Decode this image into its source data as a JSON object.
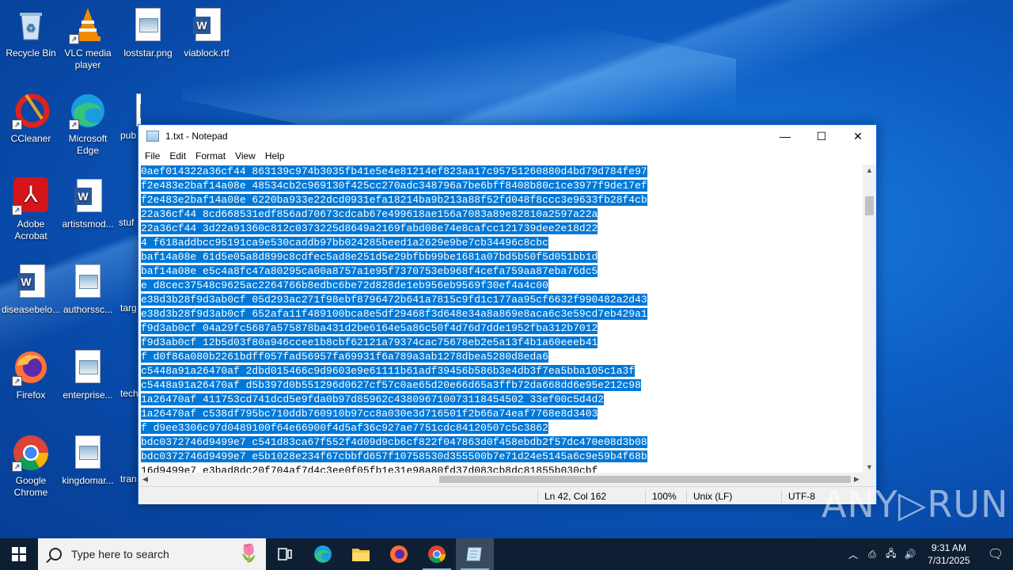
{
  "desktop": {
    "icons": [
      {
        "label": "Recycle Bin",
        "icon": "recycle-bin-icon"
      },
      {
        "label": "VLC media player",
        "icon": "vlc-icon"
      },
      {
        "label": "loststar.png",
        "icon": "image-file-icon"
      },
      {
        "label": "viablock.rtf",
        "icon": "word-document-icon"
      },
      {
        "label": "CCleaner",
        "icon": "ccleaner-icon"
      },
      {
        "label": "Microsoft Edge",
        "icon": "edge-icon"
      },
      {
        "label": "pub",
        "icon": "image-file-icon"
      },
      {
        "label": "Adobe Acrobat",
        "icon": "acrobat-icon"
      },
      {
        "label": "artistsmod...",
        "icon": "word-document-icon"
      },
      {
        "label": "stuf",
        "icon": "image-file-icon"
      },
      {
        "label": "diseasebelo...",
        "icon": "word-document-icon"
      },
      {
        "label": "authorssc...",
        "icon": "image-file-icon"
      },
      {
        "label": "targ",
        "icon": "word-document-icon"
      },
      {
        "label": "Firefox",
        "icon": "firefox-icon"
      },
      {
        "label": "enterprise...",
        "icon": "image-file-icon"
      },
      {
        "label": "tech",
        "icon": "word-document-icon"
      },
      {
        "label": "Google Chrome",
        "icon": "chrome-icon"
      },
      {
        "label": "kingdomar...",
        "icon": "image-file-icon"
      },
      {
        "label": "tran",
        "icon": "image-file-icon"
      }
    ]
  },
  "notepad": {
    "title": "1.txt - Notepad",
    "menu": [
      "File",
      "Edit",
      "Format",
      "View",
      "Help"
    ],
    "lines": [
      {
        "text": "0aef014322a36cf44 863139c974b3035fb41e5e4e81214ef823aa17c95751260880d4bd79d784fe97",
        "selected": true
      },
      {
        "text": "f2e483e2baf14a08e 48534cb2c969130f425cc270adc348796a7be6bff8408b80c1ce3977f9de17ef",
        "selected": true
      },
      {
        "text": "f2e483e2baf14a08e 6220ba933e22dcd0931efa18214ba9b213a88f52fd048f8ccc3e9633fb28f4cb",
        "selected": true
      },
      {
        "text": "22a36cf44 8cd668531edf856ad70673cdcab67e499618ae156a7083a89e82810a2597a22a",
        "selected": true
      },
      {
        "text": "22a36cf44 3d22a91360c812c0373225d8649a2169fabd08e74e8cafcc121739dee2e18d22",
        "selected": true
      },
      {
        "text": "4 f618addbcc95191ca9e530caddb97bb024285beed1a2629e9be7cb34496c8cbc",
        "selected": true
      },
      {
        "text": "baf14a08e 61d5e05a8d899c8cdfec5ad8e251d5e29bfbb99be1681a07bd5b50f5d051bb1d",
        "selected": true
      },
      {
        "text": "baf14a08e e5c4a8fc47a80295ca00a8757a1e95f7370753eb968f4cefa759aa87eba76dc5",
        "selected": true
      },
      {
        "text": "e d8cec37548c9625ac2264766b8edbc6be72d828de1eb956eb9569f30ef4a4c00",
        "selected": true
      },
      {
        "text": "e38d3b28f9d3ab0cf 05d293ac271f98ebf8796472b641a7815c9fd1c177aa95cf6632f990482a2d43",
        "selected": true
      },
      {
        "text": "e38d3b28f9d3ab0cf 652afa11f489100bca8e5df29468f3d648e34a8a869e8aca6c3e59cd7eb429a1",
        "selected": true
      },
      {
        "text": "f9d3ab0cf 04a29fc5687a575878ba431d2be6164e5a86c50f4d76d7dde1952fba312b7012",
        "selected": true
      },
      {
        "text": "f9d3ab0cf 12b5d03f80a946ccee1b8cbf62121a79374cac75678eb2e5a13f4b1a60eeeb41",
        "selected": true
      },
      {
        "text": "f d0f86a080b2261bdff057fad56957fa69931f6a789a3ab1278dbea5280d8eda6",
        "selected": true
      },
      {
        "text": "c5448a91a26470af 2dbd015466c9d9603e9e61111b61adf39456b586b3e4db3f7ea5bba105c1a3f",
        "selected": true
      },
      {
        "text": "c5448a91a26470af d5b397d0b551296d0627cf57c0ae65d20e66d65a3ffb72da668dd6e95e212c98",
        "selected": true
      },
      {
        "text": "1a26470af 411753cd741dcd5e9fda0b97d85962c438096710073118454502 33ef00c5d4d2",
        "selected": true
      },
      {
        "text": "1a26470af c538df795bc710ddb760910b97cc8a030e3d716501f2b66a74eaf7768e8d3403",
        "selected": true
      },
      {
        "text": "f d9ee3306c97d0489100f64e66900f4d5af36c927ae7751cdc84120507c5c3862",
        "selected": true
      },
      {
        "text": "bdc0372746d9499e7 c541d83ca67f552f4d09d9cb6cf822f047863d0f458ebdb2f57dc470e08d3b08",
        "selected": true
      },
      {
        "text": "bdc0372746d9499e7 e5b1028e234f67cbbfd657f10758530d355500b7e71d24e5145a6c9e59b4f68b",
        "selected": true
      },
      {
        "text": "16d9499e7 e3bad8dc20f704af7d4c3ee0f05fb1e31e98a80fd37d083cb8dc81855b030cbf",
        "selected": false
      }
    ],
    "status": {
      "position": "Ln 42, Col 162",
      "zoom": "100%",
      "line_endings": "Unix (LF)",
      "encoding": "UTF-8"
    }
  },
  "watermark": "ANY▷RUN",
  "taskbar": {
    "search_placeholder": "Type here to search",
    "apps": [
      "task-view",
      "edge",
      "file-explorer",
      "firefox",
      "chrome",
      "notepad"
    ],
    "time": "9:31 AM",
    "date": "7/31/2025"
  }
}
